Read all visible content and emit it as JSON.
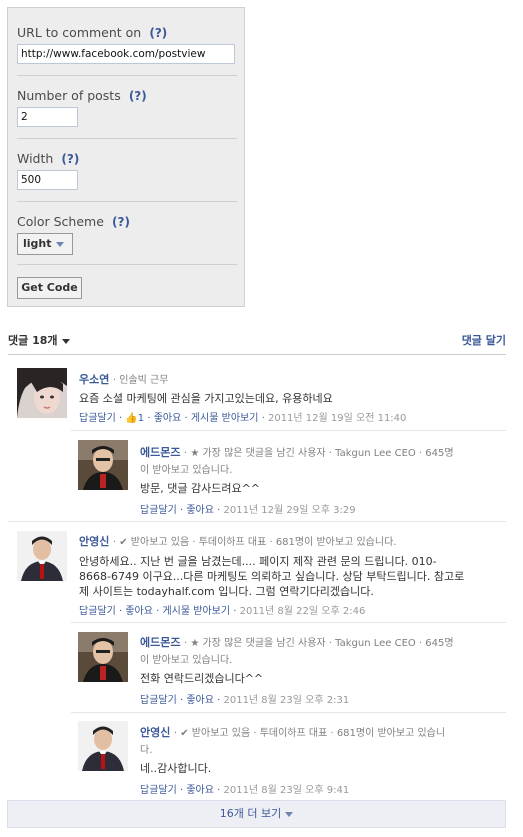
{
  "config": {
    "url_label": "URL to comment on",
    "url_value": "http://www.facebook.com/postview",
    "posts_label": "Number of posts",
    "posts_value": "2",
    "width_label": "Width",
    "width_value": "500",
    "color_label": "Color Scheme",
    "color_value": "light",
    "help": "(?)",
    "get_code": "Get Code"
  },
  "comments_header": {
    "count": "댓글 18개",
    "write": "댓글 달기"
  },
  "comments": [
    {
      "author": "우소연",
      "meta": "· 인솔빅 근무",
      "text": "요즘 소셜 마케팅에 관심을 가지고있는데요, 유용하네요",
      "actions": "답글달기 · ",
      "likes": "1",
      "actions2": " · 좋아요 · 게시물 받아보기 · ",
      "time": "2011년 12월 19일 오전 11:40",
      "reply": {
        "author": "에드몬즈",
        "meta_line1": "· ★ 가장 많은 댓글을 남긴 사용자 · Takgun Lee CEO · 645명",
        "meta_line2": "이 받아보고 있습니다.",
        "text": "방문, 댓글 감사드려요^^",
        "actions": "답글달기 · 좋아요 · ",
        "time": "2011년 12월 29일 오후 3:29"
      }
    },
    {
      "author": "안영신",
      "meta": "· ✔ 받아보고 있음 · 투데이하프 대표 · 681명이 받아보고 있습니다.",
      "text_line1": "안녕하세요.. 지난 번 글을 남겼는데.... 페이지 제작 관련 문의 드립니다. 010-",
      "text_line2": "8668-6749 이구요...다른 마케팅도 의뢰하고 싶습니다. 상담 부탁드립니다. 참고로",
      "text_line3": "제 사이트는 todayhalf.com 입니다. 그럼 연락기다리겠습니다.",
      "actions": "답글달기 · 좋아요 · 게시물 받아보기 · ",
      "time": "2011년 8월 22일 오후 2:46",
      "reply1": {
        "author": "에드몬즈",
        "meta_line1": "· ★ 가장 많은 댓글을 남긴 사용자 · Takgun Lee CEO · 645명",
        "meta_line2": "이 받아보고 있습니다.",
        "text": "전화 연락드리겠습니다^^",
        "actions": "답글달기 · 좋아요 · ",
        "time": "2011년 8월 23일 오후 2:31"
      },
      "reply2": {
        "author": "안영신",
        "meta_line1": "· ✔ 받아보고 있음 · 투데이하프 대표 · 681명이 받아보고 있습니",
        "meta_line2": "다.",
        "text": "네..감사합니다.",
        "actions": "답글달기 · 좋아요 · ",
        "time": "2011년 8월 23일 오후 9:41"
      }
    }
  ],
  "more": "16개 더 보기",
  "colors": {
    "link": "#3b5998",
    "panel": "#ededed"
  }
}
